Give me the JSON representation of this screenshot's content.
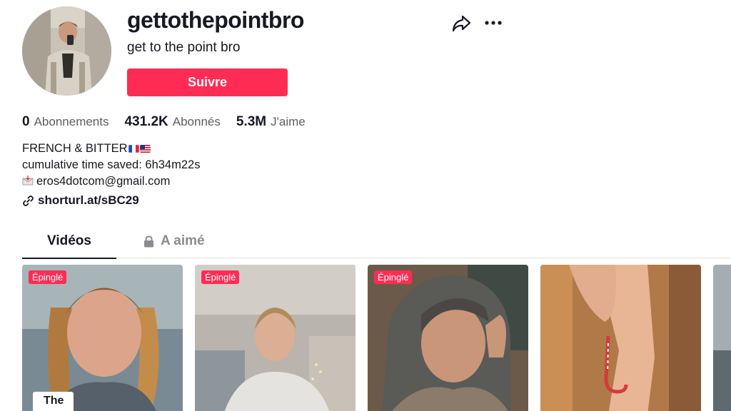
{
  "profile": {
    "username": "gettothepointbro",
    "nickname": "get to the point bro",
    "follow_label": "Suivre"
  },
  "stats": [
    {
      "value": "0",
      "label": "Abonnements"
    },
    {
      "value": "431.2K",
      "label": "Abonnés"
    },
    {
      "value": "5.3M",
      "label": "J'aime"
    }
  ],
  "bio": {
    "line1": "FRENCH & BITTER",
    "line2": "cumulative time saved: 6h34m22s",
    "line3": "eros4dotcom@gmail.com"
  },
  "link": {
    "text": "shorturl.at/sBC29"
  },
  "tabs": {
    "videos": "Vidéos",
    "liked": "A aimé"
  },
  "videos": [
    {
      "badge": "Épinglé",
      "caption": "The"
    },
    {
      "badge": "Épinglé"
    },
    {
      "badge": "Épinglé"
    },
    {}
  ],
  "colors": {
    "accent": "#fe2c55",
    "text": "#161823",
    "muted": "#8a8b91"
  }
}
